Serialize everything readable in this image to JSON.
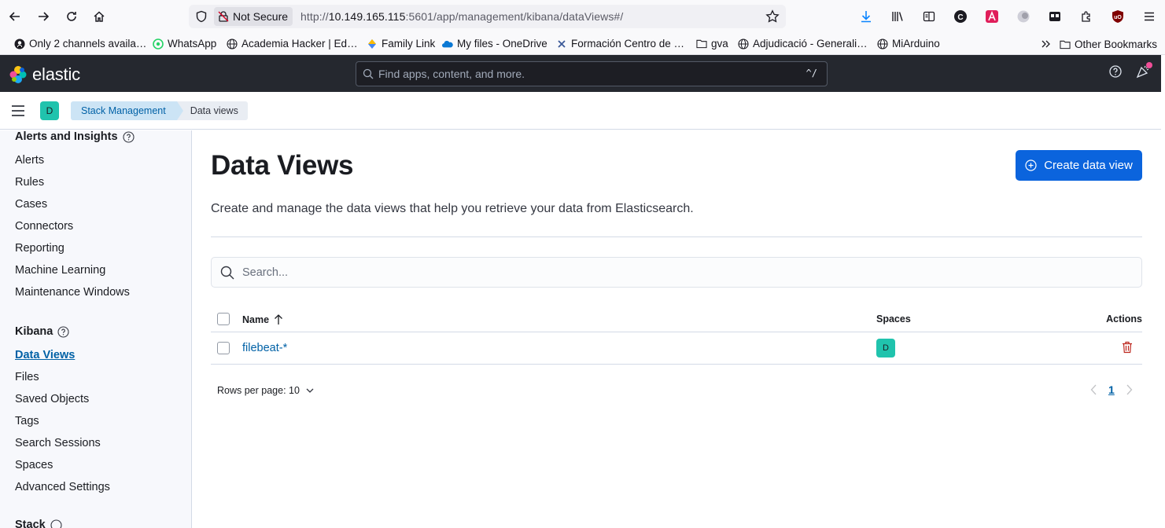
{
  "browser": {
    "not_secure": "Not Secure",
    "url_prefix": "http://",
    "url_host": "10.149.165.115",
    "url_rest": ":5601/app/management/kibana/dataViews#/",
    "bookmarks": [
      {
        "label": "Only 2 channels availa…",
        "icon": "github-icon"
      },
      {
        "label": "WhatsApp",
        "icon": "whatsapp-icon"
      },
      {
        "label": "Academia Hacker | Ed…",
        "icon": "globe-icon"
      },
      {
        "label": "Family Link",
        "icon": "family-link-icon"
      },
      {
        "label": "My files - OneDrive",
        "icon": "onedrive-icon"
      },
      {
        "label": "Formación Centro de …",
        "icon": "site-icon"
      },
      {
        "label": "gva",
        "icon": "folder-icon"
      },
      {
        "label": "Adjudicació - Generali…",
        "icon": "globe-icon"
      },
      {
        "label": "MiArduino",
        "icon": "globe-icon"
      }
    ],
    "other_bookmarks": "Other Bookmarks"
  },
  "header": {
    "brand": "elastic",
    "search_placeholder": "Find apps, content, and more.",
    "search_shortcut": "^/"
  },
  "breadcrumbs": {
    "space_initial": "D",
    "items": [
      "Stack Management",
      "Data views"
    ]
  },
  "sidebar": {
    "group1_title": "Alerts and Insights",
    "group1_items": [
      "Alerts",
      "Rules",
      "Cases",
      "Connectors",
      "Reporting",
      "Machine Learning",
      "Maintenance Windows"
    ],
    "group2_title": "Kibana",
    "group2_items": [
      "Data Views",
      "Files",
      "Saved Objects",
      "Tags",
      "Search Sessions",
      "Spaces",
      "Advanced Settings"
    ],
    "group3_title": "Stack",
    "active_item": "Data Views"
  },
  "main": {
    "title": "Data Views",
    "create_button": "Create data view",
    "description": "Create and manage the data views that help you retrieve your data from Elasticsearch.",
    "search_placeholder": "Search...",
    "columns": {
      "name": "Name",
      "spaces": "Spaces",
      "actions": "Actions"
    },
    "rows": [
      {
        "name": "filebeat-*",
        "space": "D"
      }
    ],
    "rows_per_page": "Rows per page: 10",
    "current_page": "1"
  },
  "colors": {
    "primary": "#0b64dd",
    "link": "#0061a6",
    "header_bg": "#25282f",
    "space_avatar": "#20c3ad",
    "danger": "#bd271e"
  }
}
